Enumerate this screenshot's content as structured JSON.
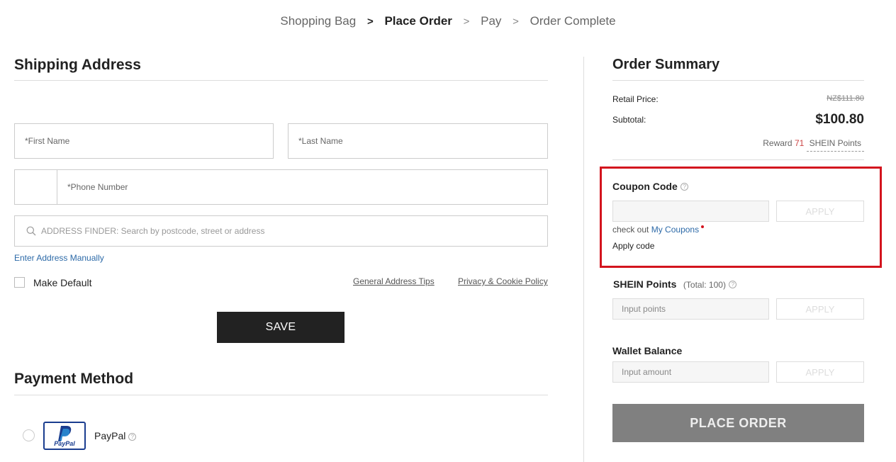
{
  "breadcrumb": {
    "step1": "Shopping Bag",
    "sep1": ">",
    "step2": "Place Order",
    "sep2": ">",
    "step3": "Pay",
    "sep3": ">",
    "step4": "Order Complete"
  },
  "shipping": {
    "title": "Shipping Address",
    "first_name_placeholder": "*First Name",
    "last_name_placeholder": "*Last Name",
    "phone_placeholder": "*Phone Number",
    "address_finder_placeholder": "ADDRESS FINDER: Search by postcode, street or address",
    "enter_manually": "Enter Address Manually",
    "make_default": "Make Default",
    "general_tips": "General Address Tips",
    "privacy_policy": "Privacy & Cookie Policy",
    "save": "SAVE"
  },
  "payment": {
    "title": "Payment Method",
    "paypal_logo_text": "PayPal",
    "paypal_label": "PayPal"
  },
  "summary": {
    "title": "Order Summary",
    "retail_label": "Retail Price:",
    "retail_value": "NZ$111.80",
    "subtotal_label": "Subtotal:",
    "subtotal_value": "$100.80",
    "reward_prefix": "Reward",
    "reward_points": "71",
    "reward_suffix": "SHEIN Points"
  },
  "coupon": {
    "title": "Coupon Code",
    "apply": "APPLY",
    "check_out": "check out",
    "my_coupons": "My Coupons",
    "apply_code": "Apply code"
  },
  "points": {
    "title": "SHEIN Points",
    "total": "(Total: 100)",
    "placeholder": "Input points",
    "apply": "APPLY"
  },
  "wallet": {
    "title": "Wallet Balance",
    "placeholder": "Input amount",
    "apply": "APPLY"
  },
  "place_order": "PLACE ORDER",
  "colors": {
    "accent_red": "#d3141e",
    "link_blue": "#2d6aa8",
    "place_order_bg": "#808080"
  }
}
